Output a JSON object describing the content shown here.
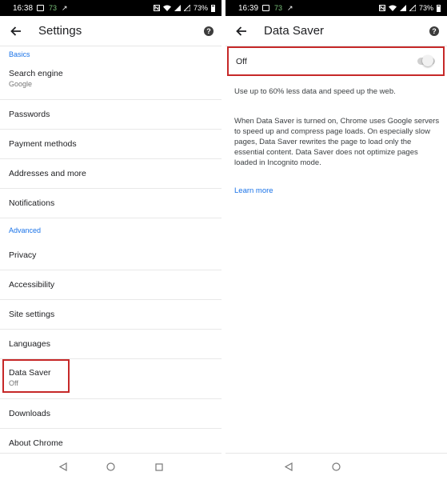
{
  "left": {
    "status": {
      "time": "16:38",
      "num": "73",
      "battery": "73%"
    },
    "toolbar": {
      "title": "Settings"
    },
    "basics_label": "Basics",
    "search_engine": {
      "label": "Search engine",
      "value": "Google"
    },
    "passwords": "Passwords",
    "payment_methods": "Payment methods",
    "addresses": "Addresses and more",
    "notifications": "Notifications",
    "advanced_label": "Advanced",
    "privacy": "Privacy",
    "accessibility": "Accessibility",
    "site_settings": "Site settings",
    "languages": "Languages",
    "data_saver": {
      "label": "Data Saver",
      "value": "Off"
    },
    "downloads": "Downloads",
    "about_chrome": "About Chrome"
  },
  "right": {
    "status": {
      "time": "16:39",
      "num": "73",
      "battery": "73%"
    },
    "toolbar": {
      "title": "Data Saver"
    },
    "toggle": {
      "label": "Off",
      "enabled": false
    },
    "intro": "Use up to 60% less data and speed up the web.",
    "description": "When Data Saver is turned on, Chrome uses Google servers to speed up and compress page loads. On especially slow pages, Data Saver rewrites the page to load only the essential content. Data Saver does not optimize pages loaded in Incognito mode.",
    "learn_more": "Learn more"
  },
  "colors": {
    "accent": "#1a73e8",
    "highlight": "#c62828",
    "statusbar": "#000000"
  },
  "icons": {
    "back": "arrow-back-icon",
    "help": "help-icon",
    "nav_back": "triangle-back-icon",
    "nav_home": "circle-home-icon",
    "nav_recents": "square-recents-icon"
  }
}
